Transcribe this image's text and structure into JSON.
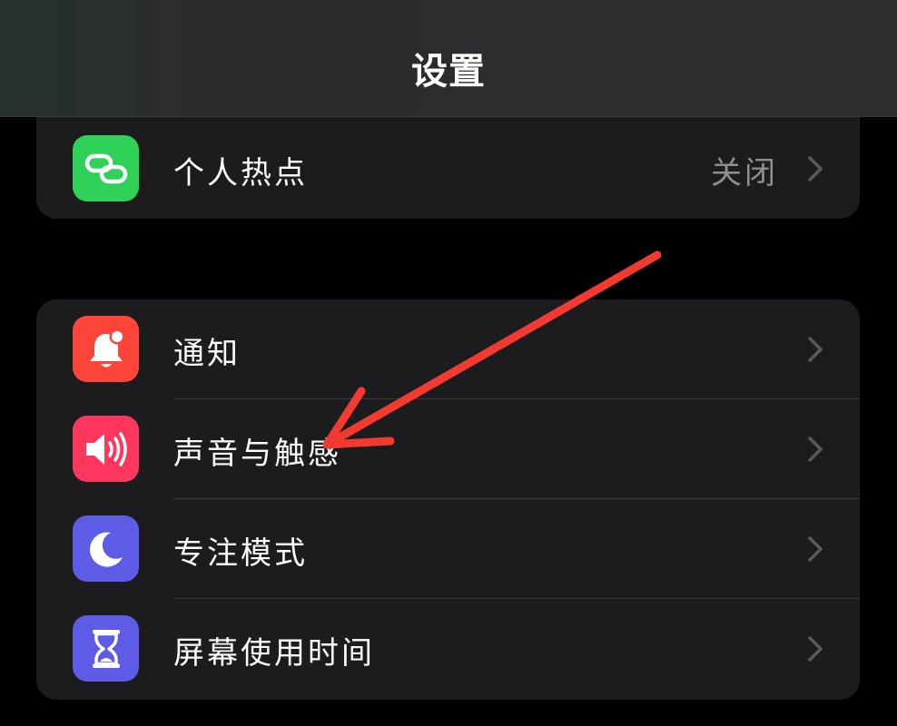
{
  "nav": {
    "title": "设置"
  },
  "sections": {
    "connectivity": {
      "items": [
        {
          "label": "个人热点",
          "value": "关闭",
          "icon": "link-icon",
          "icon_color": "#30d158"
        }
      ]
    },
    "general": {
      "items": [
        {
          "label": "通知",
          "icon": "bell-badge-icon",
          "icon_color": "#ff453a"
        },
        {
          "label": "声音与触感",
          "icon": "speaker-wave-icon",
          "icon_color": "#ff375f"
        },
        {
          "label": "专注模式",
          "icon": "moon-icon",
          "icon_color": "#5e5ce6"
        },
        {
          "label": "屏幕使用时间",
          "icon": "hourglass-icon",
          "icon_color": "#5e5ce6"
        }
      ]
    }
  },
  "annotation": {
    "arrow_color": "#f23a30",
    "points_to": "声音与触感"
  }
}
